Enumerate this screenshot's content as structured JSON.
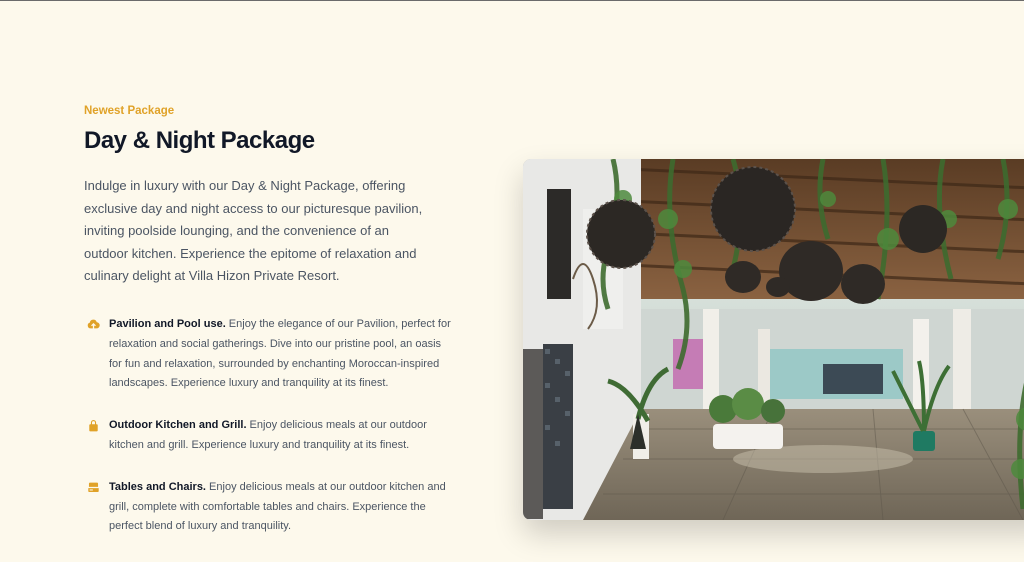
{
  "package": {
    "eyebrow": "Newest Package",
    "title": "Day & Night Package",
    "description": "Indulge in luxury with our Day & Night Package, offering exclusive day and night access to our picturesque pavilion, inviting poolside lounging, and the convenience of an outdoor kitchen. Experience the epitome of relaxation and culinary delight at Villa Hizon Private Resort."
  },
  "features": [
    {
      "icon": "cloud-upload-icon",
      "name": "Pavilion and Pool use.",
      "text": " Enjoy the elegance of our Pavilion, perfect for relaxation and social gatherings. Dive into our pristine pool, an oasis for fun and relaxation, surrounded by enchanting Moroccan-inspired landscapes. Experience luxury and tranquility at its finest."
    },
    {
      "icon": "lock-icon",
      "name": "Outdoor Kitchen and Grill.",
      "text": " Enjoy delicious meals at our outdoor kitchen and grill. Experience luxury and tranquility at its finest."
    },
    {
      "icon": "server-icon",
      "name": "Tables and Chairs.",
      "text": " Enjoy delicious meals at our outdoor kitchen and grill, complete with comfortable tables and chairs. Experience the perfect blend of luxury and tranquility."
    }
  ],
  "colors": {
    "background": "#fdf9ec",
    "accent": "#e0a228",
    "heading": "#111827",
    "body": "#4b5563"
  }
}
